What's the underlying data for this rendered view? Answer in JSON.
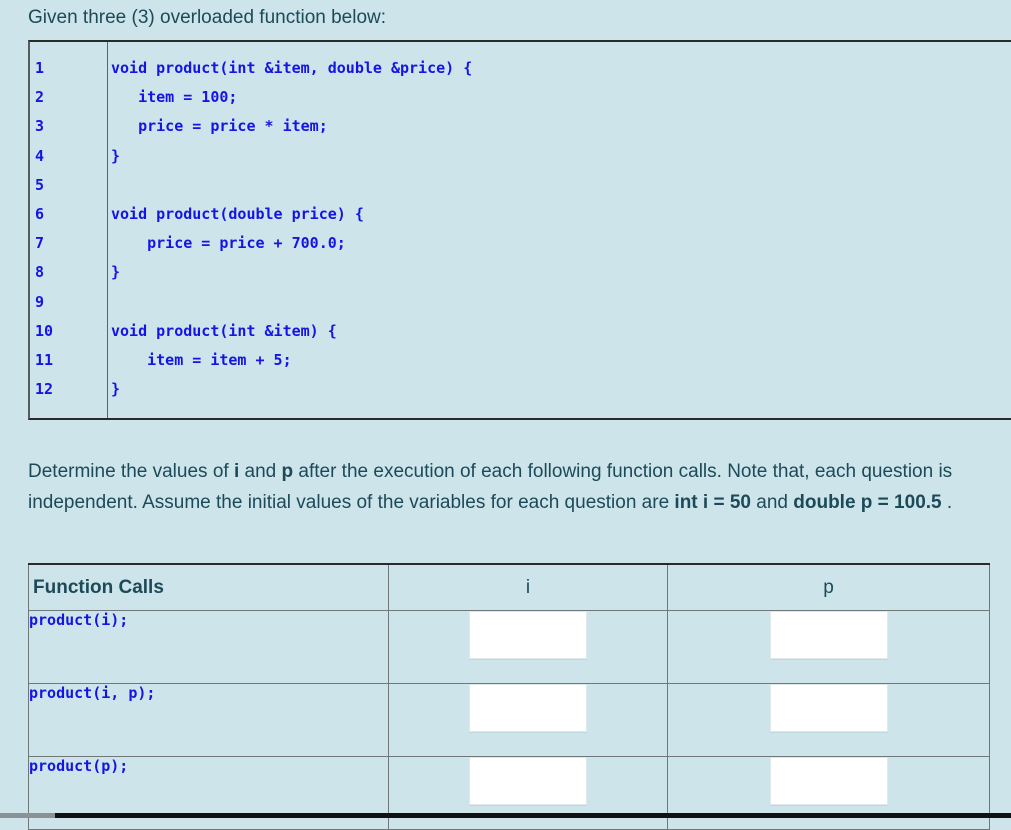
{
  "intro": {
    "text": "Given three (3) overloaded function below:"
  },
  "code_block": {
    "line_numbers": [
      "1",
      "2",
      "3",
      "4",
      "5",
      "6",
      "7",
      "8",
      "9",
      "10",
      "11",
      "12"
    ],
    "lines": [
      "void product(int &item, double &price) {",
      "   item = 100;",
      "   price = price * item;",
      "}",
      "",
      "void product(double price) {",
      "    price = price + 700.0;",
      "}",
      "",
      "void product(int &item) {",
      "    item = item + 5;",
      "}"
    ],
    "code_color": "#1414e6"
  },
  "prompt": {
    "line1_a": "Determine the values of ",
    "var_i": "i",
    "line1_b": " and ",
    "var_p": "p",
    "line1_c": " after the execution of each following function calls. Note that, each question is independent. Assume the initial values of the variables for each question are ",
    "init_i": "int i = 50",
    "line1_d": " and ",
    "init_p": "double p = 100.5",
    "line1_e": " ."
  },
  "answer_table": {
    "headers": {
      "function_calls": "Function Calls",
      "i": "i",
      "p": "p"
    },
    "rows": [
      {
        "call": "product(i);",
        "i_value": "",
        "p_value": ""
      },
      {
        "call": "product(i, p);",
        "i_value": "",
        "p_value": ""
      },
      {
        "call": "product(p);",
        "i_value": "",
        "p_value": ""
      }
    ],
    "input_placeholder": ""
  },
  "theme": {
    "background": "#cce4ea",
    "text_color": "#1d4a58",
    "code_color": "#1414e6",
    "border_color": "#6f7779"
  }
}
